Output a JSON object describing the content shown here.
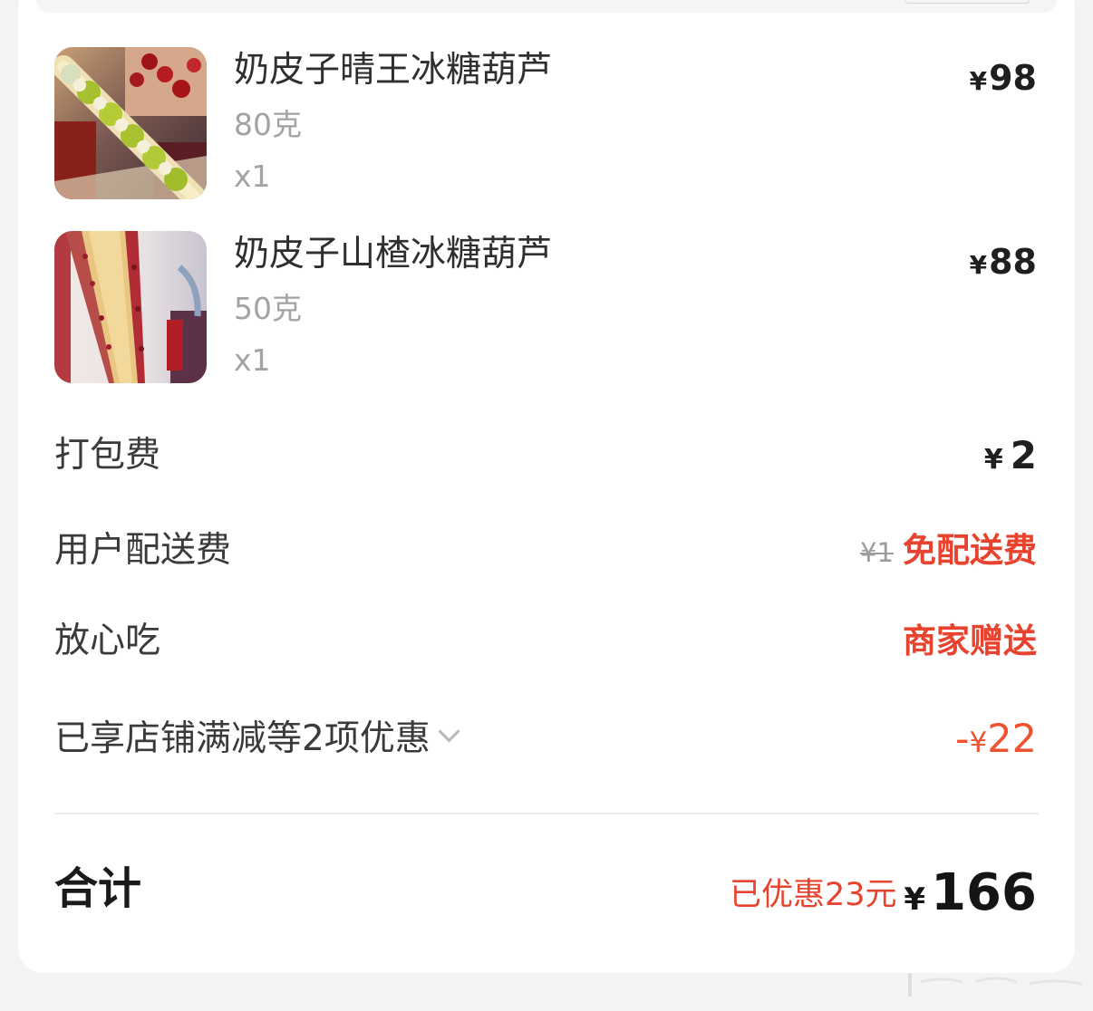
{
  "items": [
    {
      "name": "奶皮子晴王冰糖葫芦",
      "weight": "80克",
      "quantity": "x1",
      "currency": "¥",
      "price": "98",
      "thumbnail_icon": "food-photo-grape-skewer"
    },
    {
      "name": "奶皮子山楂冰糖葫芦",
      "weight": "50克",
      "quantity": "x1",
      "currency": "¥",
      "price": "88",
      "thumbnail_icon": "food-photo-hawthorn-skewer"
    }
  ],
  "fees": {
    "packing": {
      "label": "打包费",
      "currency": "¥",
      "value": "2"
    },
    "delivery": {
      "label": "用户配送费",
      "original": "¥1",
      "value": "免配送费"
    },
    "safe_eat": {
      "label": "放心吃",
      "value": "商家赠送"
    },
    "discount": {
      "label": "已享店铺满减等2项优惠",
      "sign": "-",
      "currency": "¥",
      "value": "22"
    }
  },
  "summary": {
    "label": "合计",
    "saved": "已优惠23元",
    "currency": "¥",
    "total": "166"
  },
  "colors": {
    "accent_red": "#e8432f",
    "discount_orange": "#f0512f",
    "muted_text": "#a3a3a3",
    "card_background": "#ffffff",
    "page_background": "#f4f4f4"
  },
  "icons": {
    "discount_expand": "chevron-down-icon"
  }
}
